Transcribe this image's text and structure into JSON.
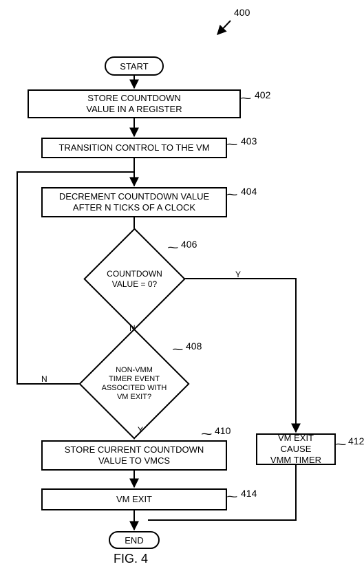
{
  "chart_data": {
    "type": "flowchart",
    "figure_number": "400",
    "caption": "FIG. 4",
    "nodes": [
      {
        "id": "start",
        "kind": "terminator",
        "text": "START"
      },
      {
        "id": "402",
        "kind": "process",
        "ref": "402",
        "text": "STORE COUNTDOWN VALUE IN A REGISTER"
      },
      {
        "id": "403",
        "kind": "process",
        "ref": "403",
        "text": "TRANSITION CONTROL TO THE VM"
      },
      {
        "id": "404",
        "kind": "process",
        "ref": "404",
        "text": "DECREMENT COUNTDOWN VALUE AFTER N TICKS OF A CLOCK"
      },
      {
        "id": "406",
        "kind": "decision",
        "ref": "406",
        "text": "COUNTDOWN VALUE = 0?"
      },
      {
        "id": "408",
        "kind": "decision",
        "ref": "408",
        "text": "NON-VMM TIMER EVENT ASSOCITED WITH VM EXIT?"
      },
      {
        "id": "410",
        "kind": "process",
        "ref": "410",
        "text": "STORE CURRENT COUNTDOWN VALUE TO VMCS"
      },
      {
        "id": "412",
        "kind": "process",
        "ref": "412",
        "text": "VM EXIT CAUSE VMM TIMER"
      },
      {
        "id": "414",
        "kind": "process",
        "ref": "414",
        "text": "VM EXIT"
      },
      {
        "id": "end",
        "kind": "terminator",
        "text": "END"
      }
    ],
    "edges": [
      {
        "from": "start",
        "to": "402"
      },
      {
        "from": "402",
        "to": "403"
      },
      {
        "from": "403",
        "to": "404"
      },
      {
        "from": "404",
        "to": "406"
      },
      {
        "from": "406",
        "to": "408",
        "label": "N"
      },
      {
        "from": "406",
        "to": "412",
        "label": "Y"
      },
      {
        "from": "408",
        "to": "410",
        "label": "Y"
      },
      {
        "from": "408",
        "to": "404",
        "label": "N"
      },
      {
        "from": "410",
        "to": "414"
      },
      {
        "from": "412",
        "to": "end"
      },
      {
        "from": "414",
        "to": "end"
      }
    ]
  },
  "labels": {
    "start": "START",
    "end": "END",
    "n402_line1": "STORE COUNTDOWN",
    "n402_line2": "VALUE IN A REGISTER",
    "n403": "TRANSITION CONTROL TO THE VM",
    "n404_line1": "DECREMENT COUNTDOWN VALUE",
    "n404_line2": "AFTER N TICKS OF A CLOCK",
    "n406_line1": "COUNTDOWN",
    "n406_line2": "VALUE = 0?",
    "n408_line1": "NON-VMM",
    "n408_line2": "TIMER EVENT",
    "n408_line3": "ASSOCITED WITH",
    "n408_line4": "VM EXIT?",
    "n410_line1": "STORE CURRENT COUNTDOWN",
    "n410_line2": "VALUE TO VMCS",
    "n412_line1": "VM EXIT CAUSE",
    "n412_line2": "VMM TIMER",
    "n414": "VM EXIT",
    "fig": "FIG. 4",
    "ref400": "400",
    "ref402": "402",
    "ref403": "403",
    "ref404": "404",
    "ref406": "406",
    "ref408": "408",
    "ref410": "410",
    "ref412": "412",
    "ref414": "414",
    "Y": "Y",
    "N": "N"
  }
}
